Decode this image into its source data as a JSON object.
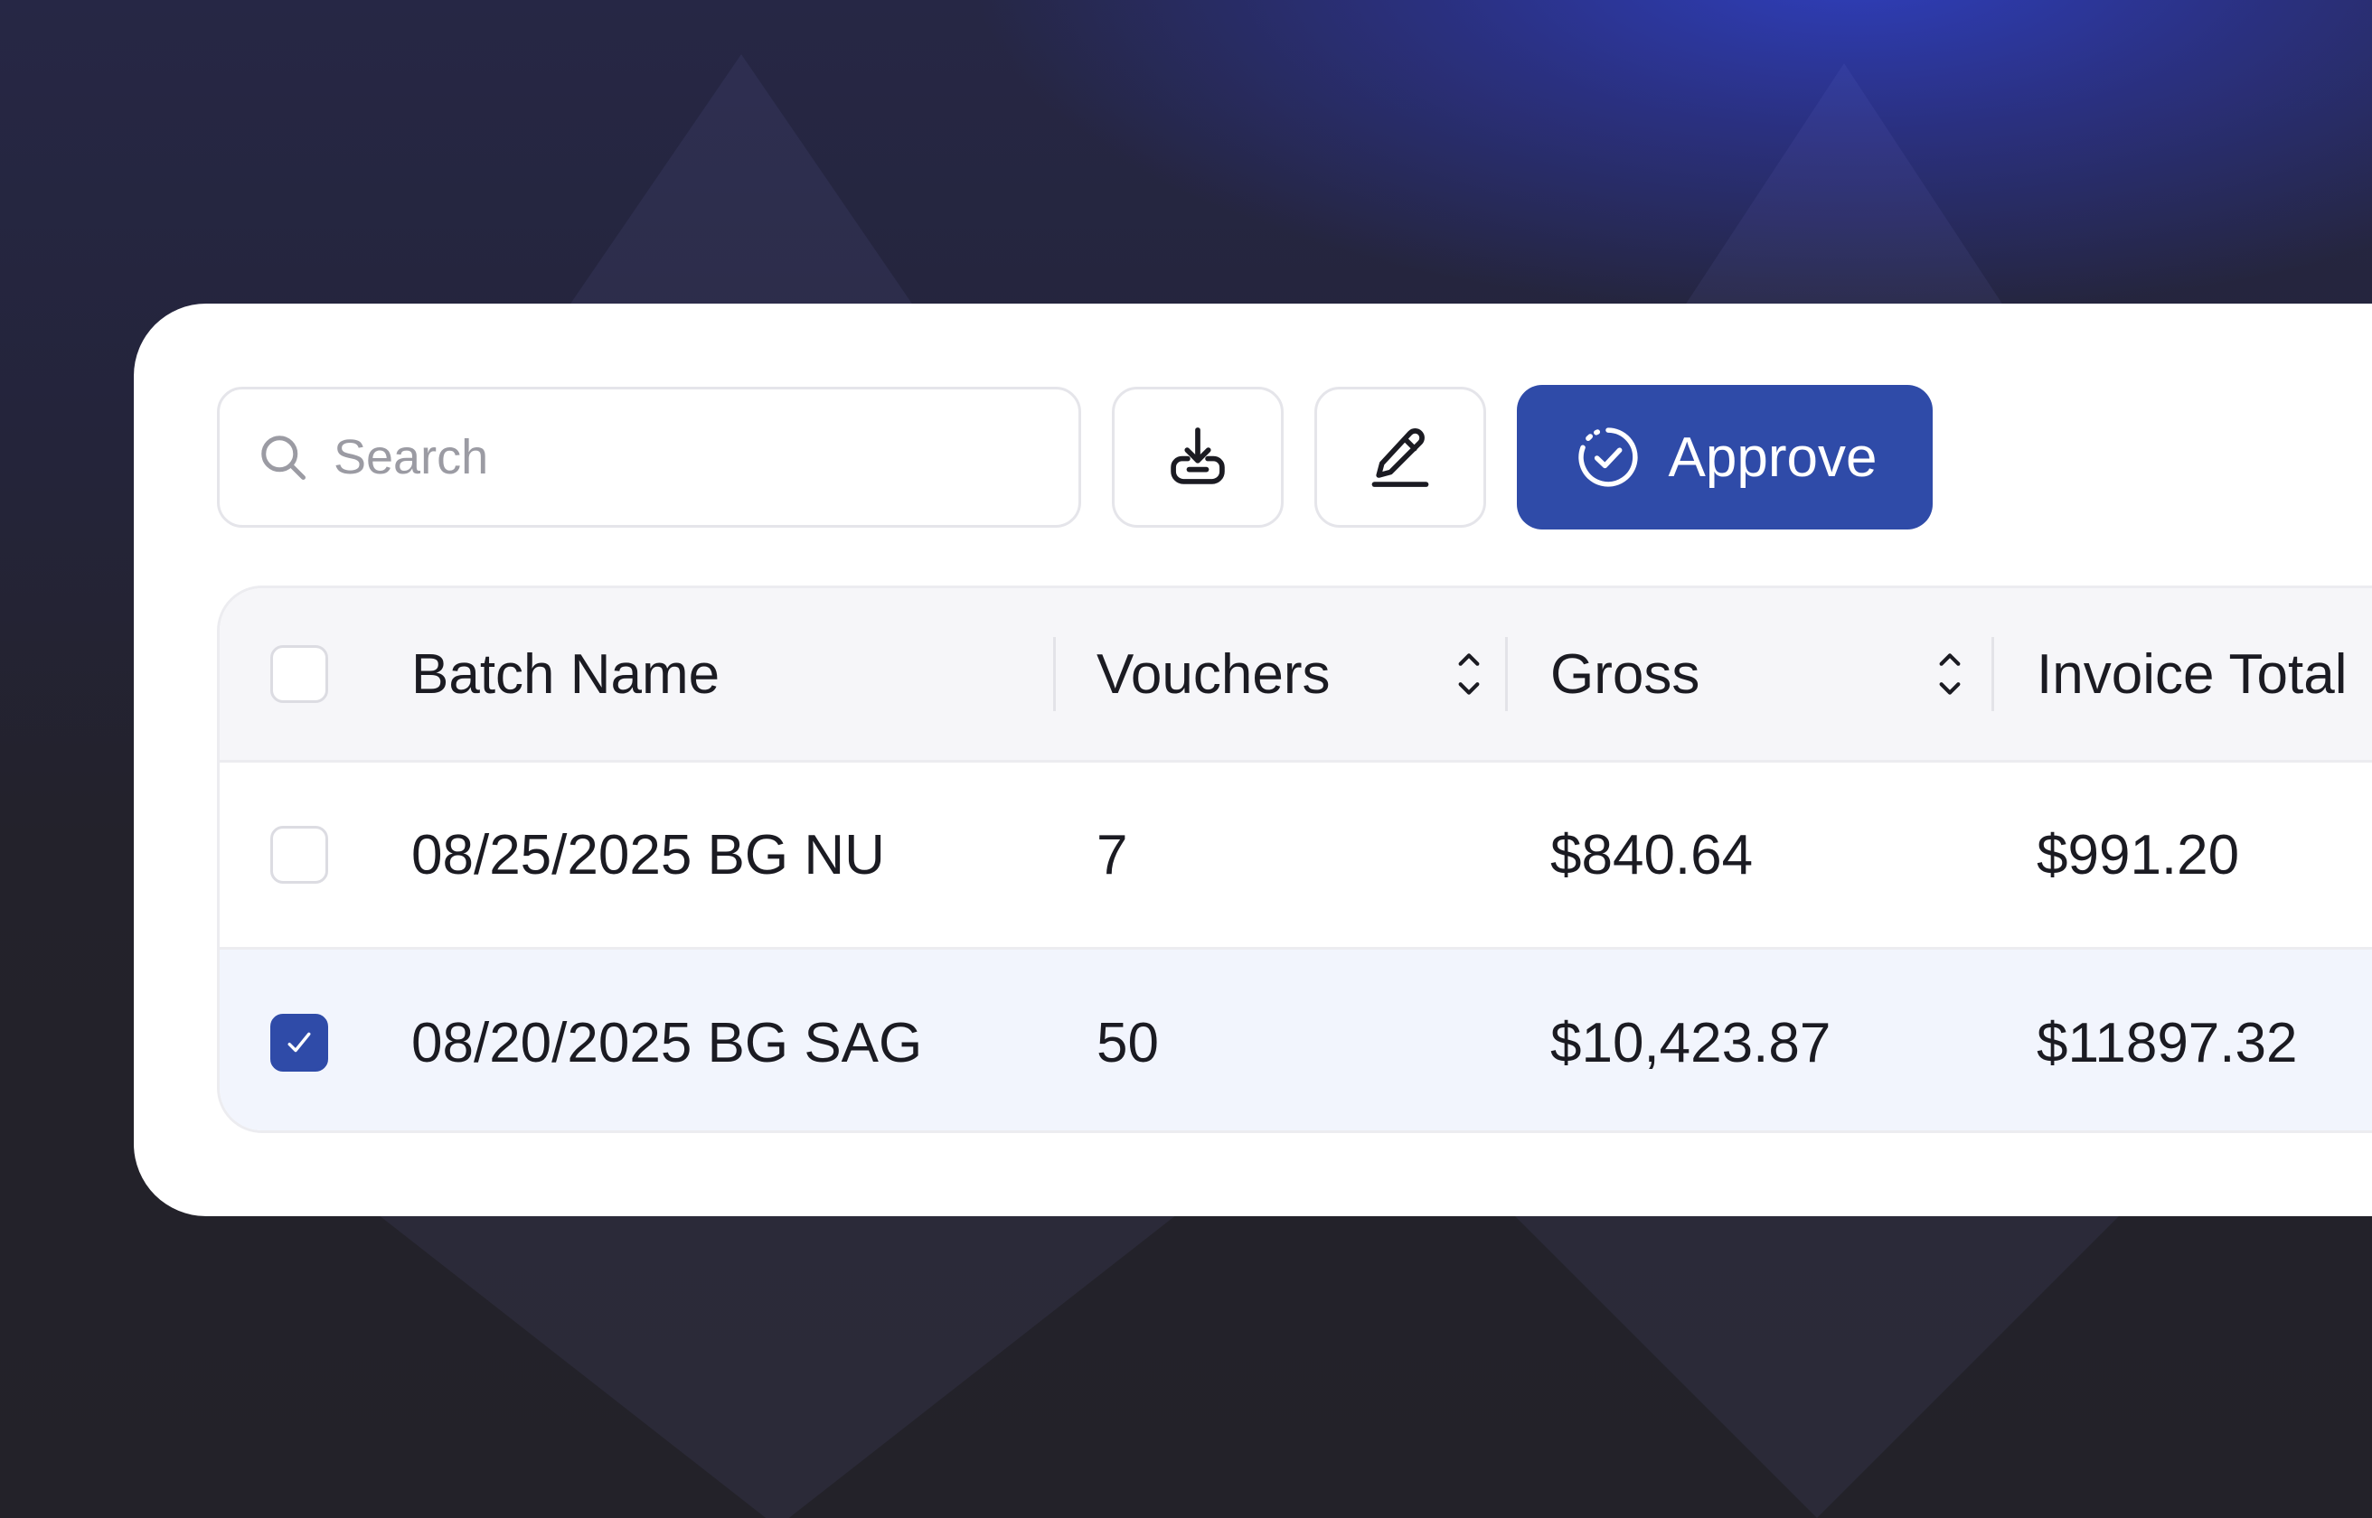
{
  "toolbar": {
    "search_placeholder": "Search",
    "search_value": "",
    "approve_label": "Approve"
  },
  "table": {
    "columns": [
      "Batch Name",
      "Vouchers",
      "Gross",
      "Invoice Total"
    ],
    "rows": [
      {
        "selected": false,
        "batch_name": "08/25/2025 BG NU",
        "vouchers": "7",
        "gross": "$840.64",
        "invoice_total": "$991.20"
      },
      {
        "selected": true,
        "batch_name": "08/20/2025 BG SAG",
        "vouchers": "50",
        "gross": "$10,423.87",
        "invoice_total": "$11897.32"
      }
    ]
  },
  "colors": {
    "accent": "#2f4ba8",
    "selected_row_bg": "#f2f5fd",
    "header_bg": "#f6f6f9"
  },
  "icons": {
    "search": "search-icon",
    "export": "download-tray-icon",
    "edit": "pencil-underline-icon",
    "approve": "circle-check-icon",
    "sort": "sort-chevrons-icon",
    "checkbox": "checkmark-icon"
  }
}
